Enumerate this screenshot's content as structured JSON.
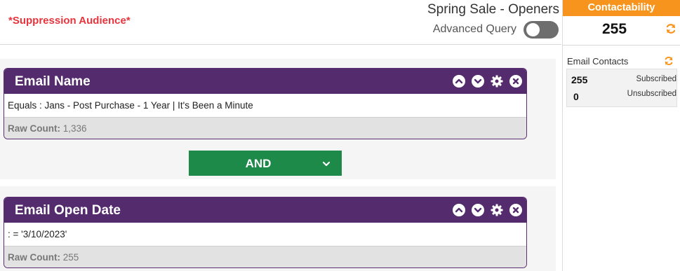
{
  "header": {
    "suppression_label": "*Suppression Audience*",
    "audience_name": "Spring Sale - Openers",
    "advanced_query_label": "Advanced Query",
    "advanced_query_on": false
  },
  "rules": [
    {
      "title": "Email Name",
      "condition": "Equals : Jans - Post Purchase - 1 Year | It's Been a Minute",
      "raw_count_label": "Raw Count:",
      "raw_count_value": "1,336"
    },
    {
      "title": "Email Open Date",
      "condition": ": = '3/10/2023'",
      "raw_count_label": "Raw Count:",
      "raw_count_value": "255"
    }
  ],
  "connector": {
    "label": "AND"
  },
  "sidebar": {
    "title": "Contactability",
    "total": "255",
    "email_contacts_label": "Email Contacts",
    "subscribed_count": "255",
    "subscribed_label": "Subscribed",
    "unsubscribed_count": "0",
    "unsubscribed_label": "Unsubscribed"
  },
  "colors": {
    "rule_header": "#542c6e",
    "and_button": "#1e8a4a",
    "contactability": "#f7941d",
    "suppression_text": "#e8343c"
  },
  "icons": [
    "chevron-up-icon",
    "chevron-down-icon",
    "gear-icon",
    "close-icon",
    "refresh-icon",
    "caret-down-icon"
  ]
}
